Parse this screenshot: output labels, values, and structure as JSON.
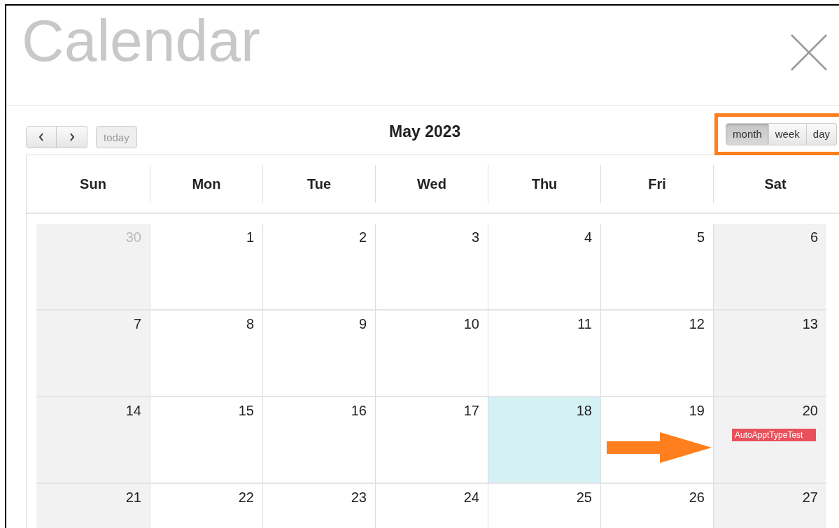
{
  "window": {
    "title": "Calendar"
  },
  "toolbar": {
    "today": {
      "label": "today",
      "disabled": true
    },
    "month_title": "May 2023",
    "views": [
      {
        "label": "month",
        "selected": true
      },
      {
        "label": "week",
        "selected": false
      },
      {
        "label": "day",
        "selected": false
      }
    ]
  },
  "weekdays": [
    "Sun",
    "Mon",
    "Tue",
    "Wed",
    "Thu",
    "Fri",
    "Sat"
  ],
  "weeks": [
    [
      {
        "day": "30",
        "other_month": true,
        "today": false
      },
      {
        "day": "1",
        "other_month": false,
        "today": false
      },
      {
        "day": "2",
        "other_month": false,
        "today": false
      },
      {
        "day": "3",
        "other_month": false,
        "today": false
      },
      {
        "day": "4",
        "other_month": false,
        "today": false
      },
      {
        "day": "5",
        "other_month": false,
        "today": false
      },
      {
        "day": "6",
        "other_month": false,
        "today": false
      }
    ],
    [
      {
        "day": "7",
        "other_month": false,
        "today": false
      },
      {
        "day": "8",
        "other_month": false,
        "today": false
      },
      {
        "day": "9",
        "other_month": false,
        "today": false
      },
      {
        "day": "10",
        "other_month": false,
        "today": false
      },
      {
        "day": "11",
        "other_month": false,
        "today": false
      },
      {
        "day": "12",
        "other_month": false,
        "today": false
      },
      {
        "day": "13",
        "other_month": false,
        "today": false
      }
    ],
    [
      {
        "day": "14",
        "other_month": false,
        "today": false
      },
      {
        "day": "15",
        "other_month": false,
        "today": false
      },
      {
        "day": "16",
        "other_month": false,
        "today": false
      },
      {
        "day": "17",
        "other_month": false,
        "today": false
      },
      {
        "day": "18",
        "other_month": false,
        "today": true
      },
      {
        "day": "19",
        "other_month": false,
        "today": false
      },
      {
        "day": "20",
        "other_month": false,
        "today": false,
        "events": [
          {
            "title": "AutoApptTypeTest",
            "color": "#e8505b"
          }
        ]
      }
    ],
    [
      {
        "day": "21",
        "other_month": false,
        "today": false
      },
      {
        "day": "22",
        "other_month": false,
        "today": false
      },
      {
        "day": "23",
        "other_month": false,
        "today": false
      },
      {
        "day": "24",
        "other_month": false,
        "today": false
      },
      {
        "day": "25",
        "other_month": false,
        "today": false
      },
      {
        "day": "26",
        "other_month": false,
        "today": false
      },
      {
        "day": "27",
        "other_month": false,
        "today": false
      }
    ]
  ]
}
